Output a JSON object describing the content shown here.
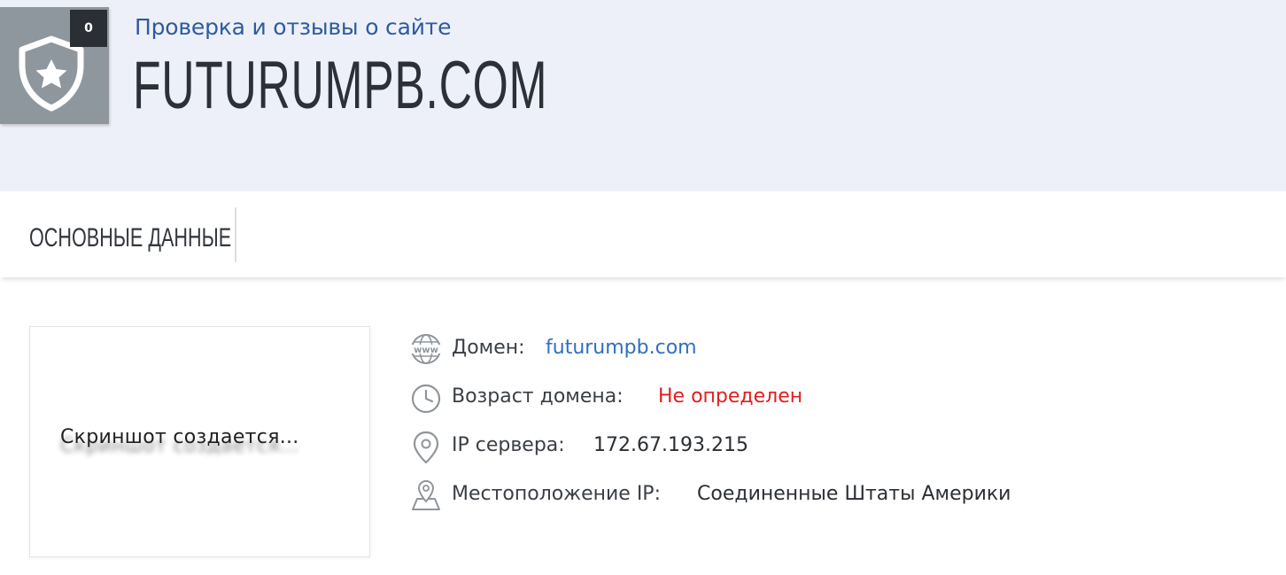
{
  "header": {
    "badge_count": "0",
    "subtitle": "Проверка и отзывы о сайте",
    "site_title": "FUTURUMPB.COM"
  },
  "tabs": [
    {
      "label": "ОСНОВНЫЕ ДАННЫЕ"
    }
  ],
  "screenshot": {
    "status_text": "Скриншот создается..."
  },
  "info": {
    "domain": {
      "label": "Домен:",
      "value": "futurumpb.com",
      "icon": "www-globe-icon"
    },
    "age": {
      "label": "Возраст домена:",
      "value": "Не определен",
      "icon": "clock-icon"
    },
    "ip": {
      "label": "IP сервера:",
      "value": "172.67.193.215",
      "icon": "map-pin-icon"
    },
    "location": {
      "label": "Местоположение IP:",
      "value": "Соединенные Штаты Америки",
      "icon": "map-location-icon"
    },
    "icon_text": "www"
  },
  "colors": {
    "header_bg": "#edf0f8",
    "badge_bg": "#8f979e",
    "count_bg": "#2b2f35",
    "subtitle": "#2d5c9c",
    "link": "#2f6fc2",
    "warning": "#e21d1d"
  }
}
